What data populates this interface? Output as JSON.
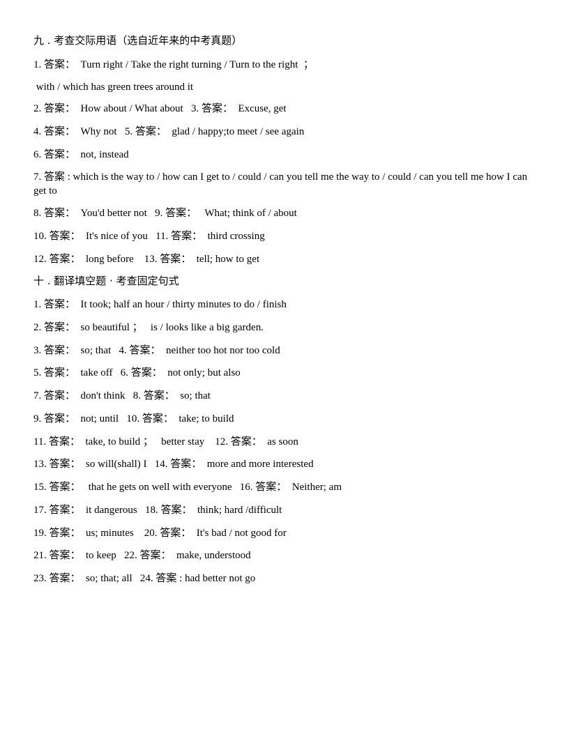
{
  "section9": {
    "title": "九 . 考查交际用语（选自近年来的中考真题）",
    "lines": [
      "1. 答案：  Turn right / Take the right turning / Turn to the right  ；",
      " with / which has green trees around it",
      "2. 答案：  How about / What about   3. 答案：  Excuse, get",
      "4. 答案：  Why not   5. 答案：  glad / happy;to meet / see again",
      "6. 答案：  not, instead",
      "7. 答案 : which is the way to / how can I get to / could / can you tell me the way to / could / can you tell me how I can get to",
      "8. 答案：  You'd better not   9. 答案：   What; think of / about",
      "10. 答案：  It's nice of you   11. 答案：  third crossing",
      "12. 答案：  long before    13. 答案：  tell; how to get"
    ]
  },
  "section10": {
    "title": "十 . 翻译填空题 · 考查固定句式",
    "lines": [
      "1. 答案：  It took; half an hour / thirty minutes to do / finish",
      "2. 答案：  so beautiful ；   is / looks like a big garden.",
      "3. 答案：  so; that   4. 答案：  neither too hot nor too cold",
      "5. 答案：  take off   6. 答案：  not only; but also",
      "7. 答案：  don't think   8. 答案：  so; that",
      "9. 答案：  not; until   10. 答案：  take; to build",
      "11. 答案：  take, to build ；   better stay    12. 答案：  as soon",
      "13. 答案：  so will(shall) I   14. 答案：  more and more interested",
      "15. 答案：   that he gets on well with everyone   16. 答案：  Neither; am",
      "17. 答案：  it dangerous   18. 答案：  think; hard /difficult",
      "19. 答案：  us; minutes    20. 答案：  It's bad / not good for",
      "21. 答案：  to keep   22. 答案：  make, understood",
      "23. 答案：  so; that; all   24. 答案 : had better not go"
    ]
  }
}
